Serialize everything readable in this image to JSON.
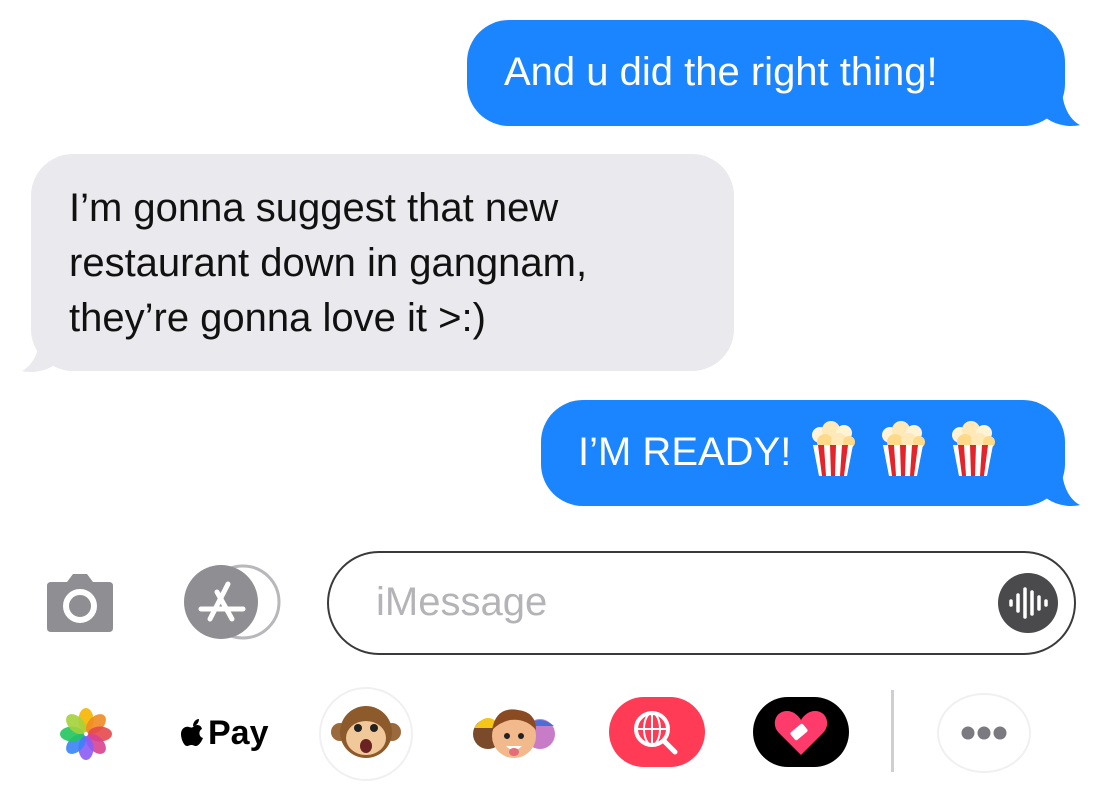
{
  "messages": [
    {
      "direction": "outgoing",
      "text": "And u did the right thing!"
    },
    {
      "direction": "incoming",
      "lines": [
        "I’m gonna suggest that new",
        "restaurant down in gangnam,",
        "they’re gonna love it >:)"
      ]
    },
    {
      "direction": "outgoing",
      "text": "I’M READY!",
      "emoji": [
        "popcorn-icon",
        "popcorn-icon",
        "popcorn-icon"
      ]
    }
  ],
  "composer": {
    "placeholder": "iMessage"
  },
  "app_drawer": {
    "apple_pay_label": "Pay",
    "items": [
      "photos-icon",
      "apple-pay",
      "animoji-icon",
      "memoji-icon",
      "web-image-search-icon",
      "digital-touch-icon",
      "more-icon"
    ]
  },
  "colors": {
    "outgoing_bubble": "#1a85ff",
    "incoming_bubble": "#e9e9ee",
    "background": "#ffffff",
    "placeholder": "#b4b4b8"
  }
}
